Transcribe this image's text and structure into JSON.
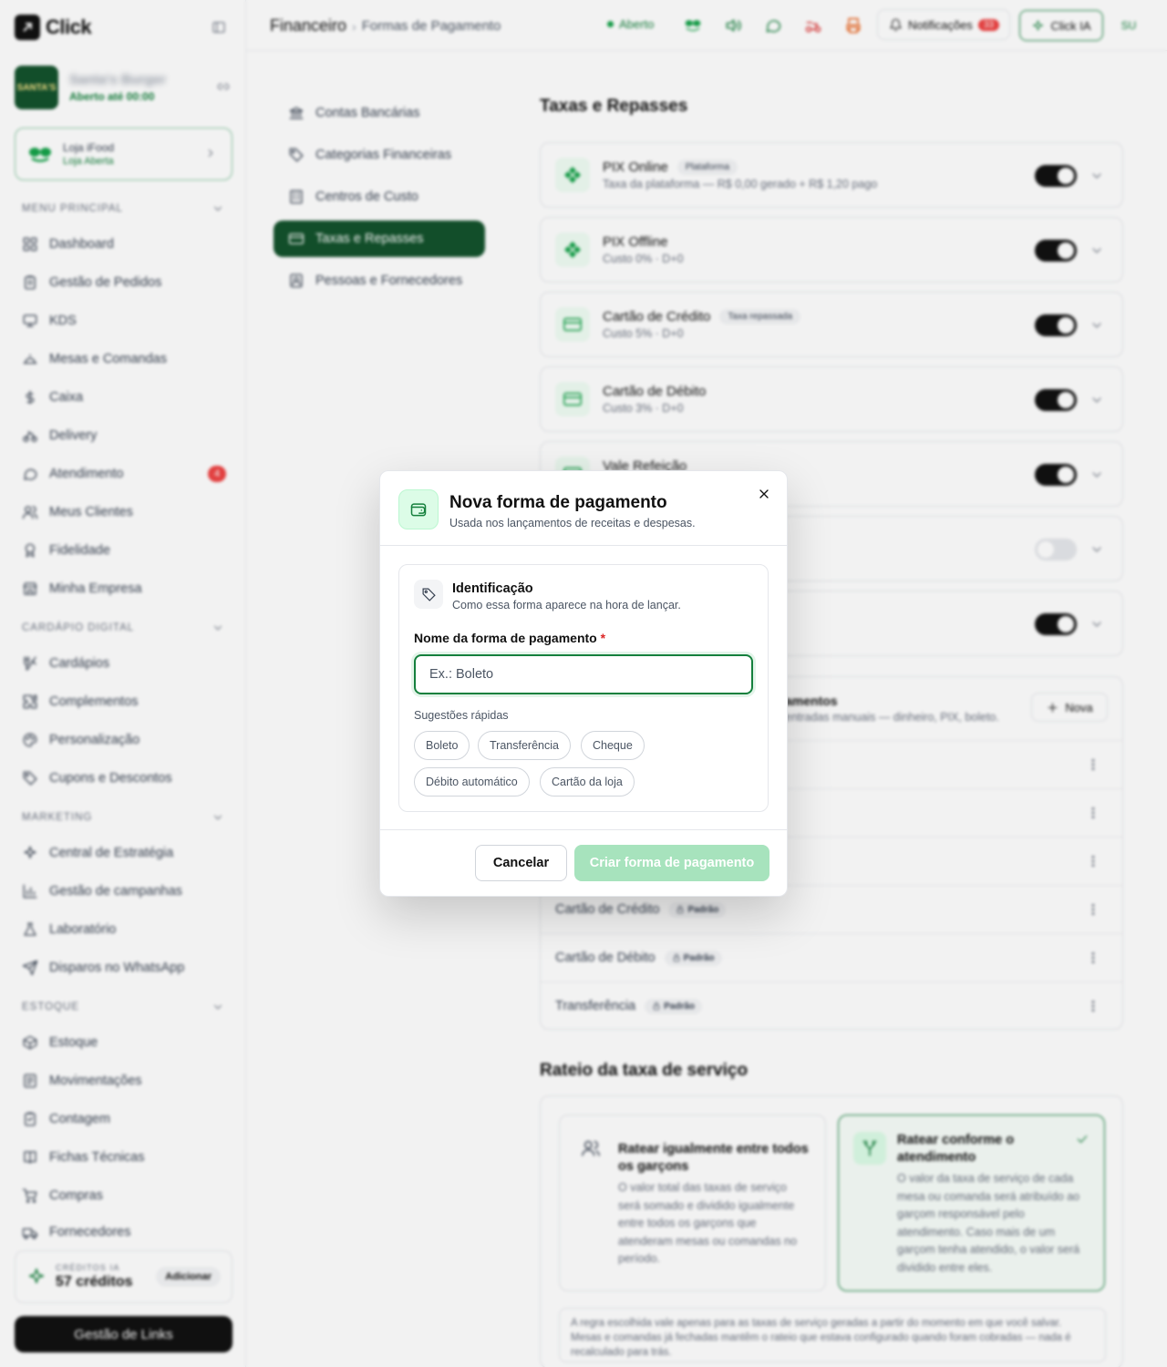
{
  "app": {
    "logo_text": "Click"
  },
  "store": {
    "avatar_text": "SANTA'S",
    "name": "Santa's Burger",
    "status": "Aberto até 00:00"
  },
  "ifood": {
    "title": "Loja iFood",
    "status": "Loja Aberta"
  },
  "sidebar": {
    "sections": [
      {
        "label": "MENU PRINCIPAL",
        "items": [
          {
            "label": "Dashboard",
            "icon": "grid-icon"
          },
          {
            "label": "Gestão de Pedidos",
            "icon": "clipboard-icon"
          },
          {
            "label": "KDS",
            "icon": "monitor-icon"
          },
          {
            "label": "Mesas e Comandas",
            "icon": "cloche-icon"
          },
          {
            "label": "Caixa",
            "icon": "dollar-icon"
          },
          {
            "label": "Delivery",
            "icon": "bike-icon"
          },
          {
            "label": "Atendimento",
            "icon": "chat-icon",
            "badge": "4"
          },
          {
            "label": "Meus Clientes",
            "icon": "users-icon"
          },
          {
            "label": "Fidelidade",
            "icon": "award-icon"
          },
          {
            "label": "Minha Empresa",
            "icon": "store-icon"
          }
        ]
      },
      {
        "label": "CARDÁPIO DIGITAL",
        "items": [
          {
            "label": "Cardápios",
            "icon": "utensils-icon"
          },
          {
            "label": "Complementos",
            "icon": "puzzle-icon"
          },
          {
            "label": "Personalização",
            "icon": "palette-icon"
          },
          {
            "label": "Cupons e Descontos",
            "icon": "tag-icon"
          }
        ]
      },
      {
        "label": "MARKETING",
        "items": [
          {
            "label": "Central de Estratégia",
            "icon": "sparkles-icon"
          },
          {
            "label": "Gestão de campanhas",
            "icon": "bar-chart-icon"
          },
          {
            "label": "Laboratório",
            "icon": "flask-icon"
          },
          {
            "label": "Disparos no WhatsApp",
            "icon": "send-icon"
          }
        ]
      },
      {
        "label": "ESTOQUE",
        "items": [
          {
            "label": "Estoque",
            "icon": "box-icon"
          },
          {
            "label": "Movimentações",
            "icon": "list-icon"
          },
          {
            "label": "Contagem",
            "icon": "clipboard-check-icon"
          },
          {
            "label": "Fichas Técnicas",
            "icon": "book-icon"
          },
          {
            "label": "Compras",
            "icon": "cart-icon"
          },
          {
            "label": "Fornecedores",
            "icon": "truck-icon"
          }
        ]
      }
    ]
  },
  "credits": {
    "label": "CRÉDITOS IA",
    "value": "57 créditos",
    "button": "Adicionar"
  },
  "links_button": "Gestão de Links",
  "header": {
    "breadcrumb_1": "Financeiro",
    "breadcrumb_sep": "›",
    "breadcrumb_2": "Formas de Pagamento",
    "status": "Aberto",
    "notifications_label": "Notificações",
    "notifications_count": "33",
    "ia_label": "Click IA",
    "user_initials": "SU"
  },
  "settings_nav": [
    {
      "label": "Contas Bancárias",
      "icon": "bank-icon",
      "active": false
    },
    {
      "label": "Categorias Financeiras",
      "icon": "tag-icon",
      "active": false
    },
    {
      "label": "Centros de Custo",
      "icon": "building-icon",
      "active": false
    },
    {
      "label": "Taxas e Repasses",
      "icon": "card-icon",
      "active": true
    },
    {
      "label": "Pessoas e Fornecedores",
      "icon": "contact-icon",
      "active": false
    }
  ],
  "taxes": {
    "heading": "Taxas e Repasses",
    "methods": [
      {
        "title": "PIX Online",
        "tag": "Plataforma",
        "subtitle": "Taxa da plataforma — R$ 0,00 gerado + R$ 1,20 pago",
        "enabled": true,
        "icon": "pix-icon"
      },
      {
        "title": "PIX Offline",
        "tag": "",
        "subtitle": "Custo 0% · D+0",
        "enabled": true,
        "icon": "pix-icon"
      },
      {
        "title": "Cartão de Crédito",
        "tag": "Taxa repassada",
        "subtitle": "Custo 5% · D+0",
        "enabled": true,
        "icon": "card-icon"
      },
      {
        "title": "Cartão de Débito",
        "tag": "",
        "subtitle": "Custo 3% · D+0",
        "enabled": true,
        "icon": "card-icon"
      },
      {
        "title": "Vale Refeição",
        "tag": "",
        "subtitle": "",
        "enabled": true,
        "icon": "card-icon"
      },
      {
        "title": "",
        "tag": "",
        "subtitle": "",
        "enabled": false,
        "icon": ""
      },
      {
        "title": "",
        "tag": "",
        "subtitle": "",
        "enabled": true,
        "icon": ""
      }
    ]
  },
  "manual_methods": {
    "title": "amentos",
    "subtitle": "entradas manuais — dinheiro, PIX, boleto.",
    "new_button": "Nova",
    "rows": [
      {
        "name": "",
        "badge": ""
      },
      {
        "name": "",
        "badge": ""
      },
      {
        "name": "",
        "badge": ""
      },
      {
        "name": "Cartão de Crédito",
        "badge": "Padrão"
      },
      {
        "name": "Cartão de Débito",
        "badge": "Padrão"
      },
      {
        "name": "Transferência",
        "badge": "Padrão"
      }
    ]
  },
  "rateio": {
    "heading": "Rateio da taxa de serviço",
    "options": [
      {
        "title": "Ratear igualmente entre todos os garçons",
        "desc": "O valor total das taxas de serviço será somado e dividido igualmente entre todos os garçons que atenderam mesas ou comandas no período.",
        "selected": false
      },
      {
        "title": "Ratear conforme o atendimento",
        "desc": "O valor da taxa de serviço de cada mesa ou comanda será atribuído ao garçom responsável pelo atendimento. Caso mais de um garçom tenha atendido, o valor será dividido entre eles.",
        "selected": true
      }
    ],
    "note": "A regra escolhida vale apenas para as taxas de serviço geradas a partir do momento em que você salvar. Mesas e comandas já fechadas mantêm o rateio que estava configurado quando foram cobradas — nada é recalculado para trás."
  },
  "modal": {
    "title": "Nova forma de pagamento",
    "subtitle": "Usada nos lançamentos de receitas e despesas.",
    "section_title": "Identificação",
    "section_subtitle": "Como essa forma aparece na hora de lançar.",
    "field_label": "Nome da forma de pagamento",
    "required_mark": "*",
    "field_value": "",
    "field_placeholder": "Ex.: Boleto",
    "suggestions_label": "Sugestões rápidas",
    "suggestions": [
      "Boleto",
      "Transferência",
      "Cheque",
      "Débito automático",
      "Cartão da loja"
    ],
    "cancel_label": "Cancelar",
    "submit_label": "Criar forma de pagamento"
  },
  "colors": {
    "brand": "#15803d",
    "brand_dark": "#14532d",
    "danger": "#ef4444",
    "submit_disabled": "#a7e3bd"
  }
}
